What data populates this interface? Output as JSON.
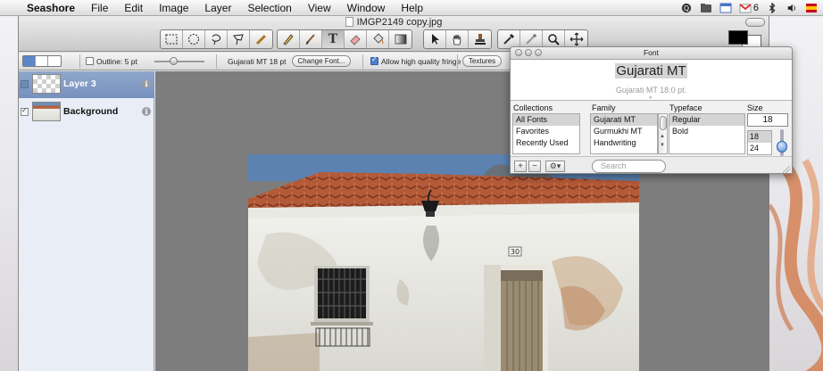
{
  "menubar": {
    "app_name": "Seashore",
    "items": [
      "File",
      "Edit",
      "Image",
      "Layer",
      "Selection",
      "View",
      "Window",
      "Help"
    ],
    "status": {
      "mail_count": "6"
    }
  },
  "window": {
    "title": "IMGP2149 copy.jpg",
    "tools": [
      "rect-select-icon",
      "ellipse-select-icon",
      "lasso-icon",
      "polygon-lasso-icon",
      "wand-icon",
      "pencil-icon",
      "brush-icon",
      "text-tool-icon",
      "eraser-icon",
      "bucket-icon",
      "gradient-icon",
      "pointer-icon",
      "hand-icon",
      "stamp-icon",
      "eyedropper-icon",
      "smudge-icon",
      "zoom-icon",
      "move-icon"
    ],
    "text_tool_glyph": "T",
    "colors": {
      "foreground": "#000000",
      "background": "#ffffff"
    }
  },
  "options": {
    "outline_label": "Outline: 5 pt",
    "font_label": "Gujarati MT 18 pt",
    "change_font_button": "Change Font...",
    "fringe_label": "Allow high quality fringe",
    "textures_button": "Textures"
  },
  "layers": [
    {
      "name": "Layer 3",
      "selected": true,
      "visible": false
    },
    {
      "name": "Background",
      "selected": false,
      "visible": true
    }
  ],
  "font_panel": {
    "title": "Font",
    "sample_text": "Gujarati MT",
    "sample_desc": "Gujarati MT 18.0 pt.",
    "collections_header": "Collections",
    "family_header": "Family",
    "typeface_header": "Typeface",
    "size_header": "Size",
    "collections": [
      "All Fonts",
      "Favorites",
      "Recently Used"
    ],
    "families": [
      "Gujarati MT",
      "Gurmukhi MT",
      "Handwriting"
    ],
    "typefaces": [
      "Regular",
      "Bold"
    ],
    "size_value": "18",
    "sizes": [
      "18",
      "24"
    ],
    "search_placeholder": "Search",
    "add_button": "+",
    "remove_button": "−",
    "gear_button": "⚙▾"
  },
  "photo": {
    "house_number": "30"
  }
}
